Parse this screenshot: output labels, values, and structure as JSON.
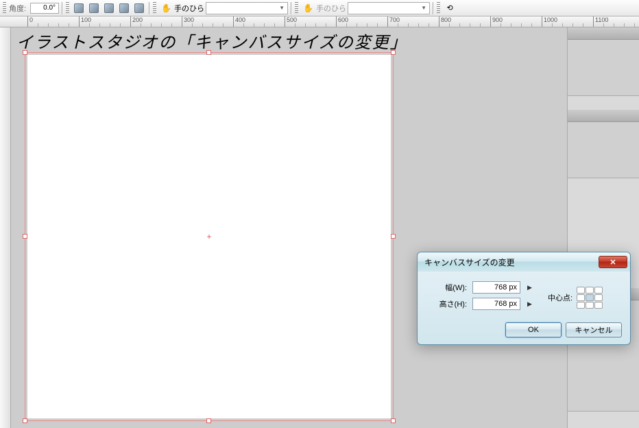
{
  "toolbar": {
    "angle_label": "角度:",
    "angle_value": "0.0°",
    "palm_label1": "手のひら",
    "palm_label2": "手のひら"
  },
  "ruler": {
    "marks": [
      0,
      100,
      200,
      300,
      400,
      500,
      600,
      700,
      800,
      900,
      1000,
      1100
    ]
  },
  "overlay_title": "イラストスタジオの「キャンバスサイズの変更」",
  "dialog": {
    "title": "キャンバスサイズの変更",
    "width_label": "幅(W):",
    "width_value": "768 px",
    "height_label": "高さ(H):",
    "height_value": "768 px",
    "anchor_label": "中心点:",
    "ok_label": "OK",
    "cancel_label": "キャンセル"
  }
}
